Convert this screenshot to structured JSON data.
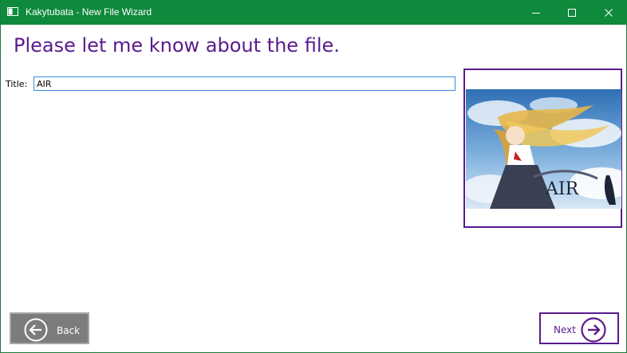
{
  "window": {
    "title": "Kakytubata - New File Wizard",
    "accent_color": "#0f8a3c",
    "controls": [
      "minimize-icon",
      "maximize-icon",
      "close-icon"
    ]
  },
  "page": {
    "heading": "Please let me know about the file.",
    "heading_color": "#5a1a8c"
  },
  "form": {
    "title_label": "Title:",
    "title_value": "AIR"
  },
  "preview": {
    "image_text": "AIR"
  },
  "nav": {
    "back_label": "Back",
    "next_label": "Next"
  }
}
